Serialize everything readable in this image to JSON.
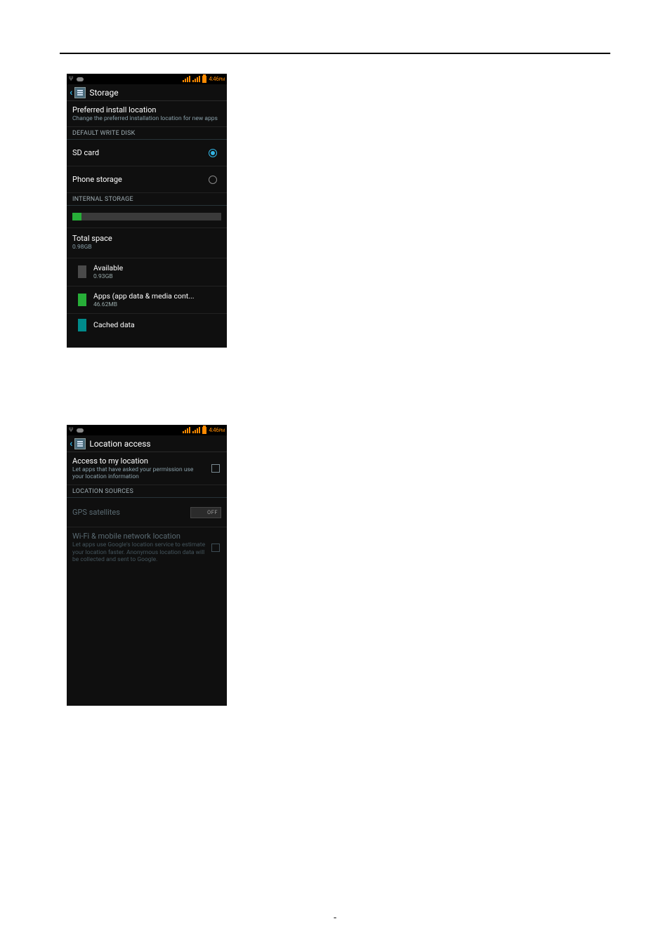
{
  "doc": {
    "footer_mark": "-"
  },
  "status": {
    "time": "4:46",
    "ampm": "PM"
  },
  "storage": {
    "header_title": "Storage",
    "pref_title": "Preferred install location",
    "pref_sub": "Change the preferred installation location for new apps",
    "default_disk_header": "DEFAULT WRITE DISK",
    "sd_card": "SD card",
    "phone_storage": "Phone storage",
    "internal_header": "INTERNAL STORAGE",
    "fill_percent": 6,
    "total_title": "Total space",
    "total_val": "0.98GB",
    "avail_title": "Available",
    "avail_val": "0.93GB",
    "apps_title": "Apps (app data & media cont...",
    "apps_val": "46.62MB",
    "cached_title": "Cached data"
  },
  "location": {
    "header_title": "Location access",
    "access_title": "Access to my location",
    "access_sub": "Let apps that have asked your permission use your location information",
    "sources_header": "LOCATION SOURCES",
    "gps_title": "GPS satellites",
    "gps_state": "OFF",
    "wifi_title": "Wi-Fi & mobile network location",
    "wifi_sub": "Let apps use Google's location service to estimate your location faster. Anonymous location data will be collected and sent to Google."
  }
}
